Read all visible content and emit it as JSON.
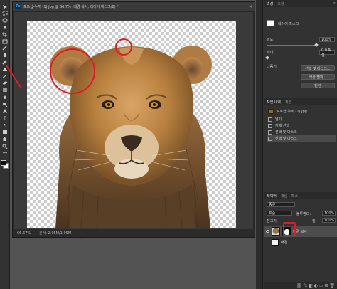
{
  "document": {
    "title": "포토샵-누끼 (1).jpg @ 66.7% (배경 복사, 레이어 마스크/8) *",
    "close_glyph": "×",
    "app_logo": "Ps",
    "zoom": "66.67%",
    "doc_info": "문서: 2.05M/1.99M",
    "status_arrow": "›"
  },
  "toolbar": {
    "tools": [
      "move-tool-icon",
      "marquee-tool-icon",
      "lasso-tool-icon",
      "quick-select-icon",
      "crop-tool-icon",
      "frame-tool-icon",
      "eyedropper-icon",
      "healing-brush-icon",
      "brush-tool-icon",
      "clone-stamp-icon",
      "history-brush-icon",
      "eraser-tool-icon",
      "gradient-tool-icon",
      "blur-tool-icon",
      "dodge-tool-icon",
      "pen-tool-icon",
      "type-tool-icon",
      "path-select-icon",
      "shape-tool-icon",
      "hand-tool-icon",
      "zoom-tool-icon",
      "more-tools-icon"
    ]
  },
  "properties": {
    "tabs": [
      "속성",
      "조정"
    ],
    "menu": "≡",
    "mask_label": "레이어 마스크",
    "density_label": "밀도:",
    "density_value": "100%",
    "feather_label": "페더:",
    "feather_value": "0.0 픽셀",
    "refine_label": "다듬기:",
    "btn_select_mask": "선택 및 마스크...",
    "btn_color_range": "색상 범위...",
    "btn_invert": "반전"
  },
  "history": {
    "tabs": [
      "작업 내역",
      "자연"
    ],
    "snapshot": "포토샵-누끼 (1).jpg",
    "items": [
      "열기",
      "개체 선택",
      "선택 및 마스크",
      "선택 및 마스크"
    ]
  },
  "layers": {
    "tabs": [
      "레이어",
      "채널",
      "패스"
    ],
    "filter_label": "종류",
    "blend_mode": "표준",
    "opacity_label": "불투명도:",
    "opacity_value": "100%",
    "lock_label": "잠그기:",
    "fill_label": "칠:",
    "fill_value": "100%",
    "rows": [
      {
        "name": "배경 복사"
      },
      {
        "name": "배경"
      }
    ],
    "bottom_icons": "⛓ fx ◧ ◐ ▭ ⊞ 🗑"
  },
  "colors": {
    "annotation": "#e01b24",
    "panel_bg": "#323232",
    "workspace_bg": "#535353"
  }
}
